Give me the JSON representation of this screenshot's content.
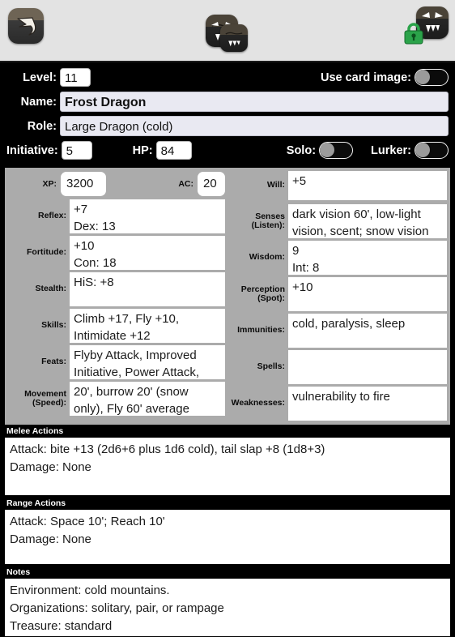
{
  "toolbar": {
    "back_icon": "back-arrow-icon",
    "monsters_icon": "monster-group-icon",
    "lock_icon": "monster-lock-icon"
  },
  "form": {
    "level_label": "Level:",
    "level_value": "11",
    "use_card_image_label": "Use card image:",
    "use_card_image_on": false,
    "name_label": "Name:",
    "name_value": "Frost Dragon",
    "role_label": "Role:",
    "role_value": "Large Dragon (cold)",
    "initiative_label": "Initiative:",
    "initiative_value": "5",
    "hp_label": "HP:",
    "hp_value": "84",
    "solo_label": "Solo:",
    "solo_on": false,
    "lurker_label": "Lurker:",
    "lurker_on": false
  },
  "stats": {
    "xp_label": "XP:",
    "xp_value": "3200",
    "ac_label": "AC:",
    "ac_value": "20",
    "left": [
      {
        "label": "Reflex:",
        "value": "+7\nDex: 13"
      },
      {
        "label": "Fortitude:",
        "value": "+10\nCon: 18"
      },
      {
        "label": "Stealth:",
        "value": "HiS: +8"
      },
      {
        "label": "Skills:",
        "value": "Climb +17, Fly +10, Intimidate +12"
      },
      {
        "label": "Feats:",
        "value": "Flyby Attack, Improved Initiative, Power Attack, Vital"
      },
      {
        "label": "Movement (Speed):",
        "value": "20', burrow 20' (snow only), Fly 60' average"
      }
    ],
    "right": [
      {
        "label": "Will:",
        "value": "+5"
      },
      {
        "label": "Senses (Listen):",
        "value": "dark vision 60', low-light vision, scent; snow vision"
      },
      {
        "label": "Wisdom:",
        "value": "9\nInt: 8"
      },
      {
        "label": "Perception (Spot):",
        "value": "+10"
      },
      {
        "label": "Immunities:",
        "value": "cold, paralysis, sleep"
      },
      {
        "label": "Spells:",
        "value": ""
      },
      {
        "label": "Weaknesses:",
        "value": "vulnerability to fire"
      }
    ]
  },
  "sections": {
    "melee": {
      "title": "Melee Actions",
      "line1": "Attack: bite +13 (2d6+6 plus 1d6 cold), tail slap +8 (1d8+3)",
      "line2": "Damage: None"
    },
    "range": {
      "title": "Range Actions",
      "line1": "Attack: Space 10'; Reach 10'",
      "line2": "Damage: None"
    },
    "notes": {
      "title": "Notes",
      "line1": "Environment: cold mountains.",
      "line2": "Organizations: solitary, pair, or rampage",
      "line3": "Treasure: standard"
    }
  },
  "colors": {
    "panel_gray": "#ababab",
    "field_blue_white": "#e9e9f2",
    "toolbar_gray": "#e3e3e3",
    "lock_green": "#2ba34a"
  }
}
